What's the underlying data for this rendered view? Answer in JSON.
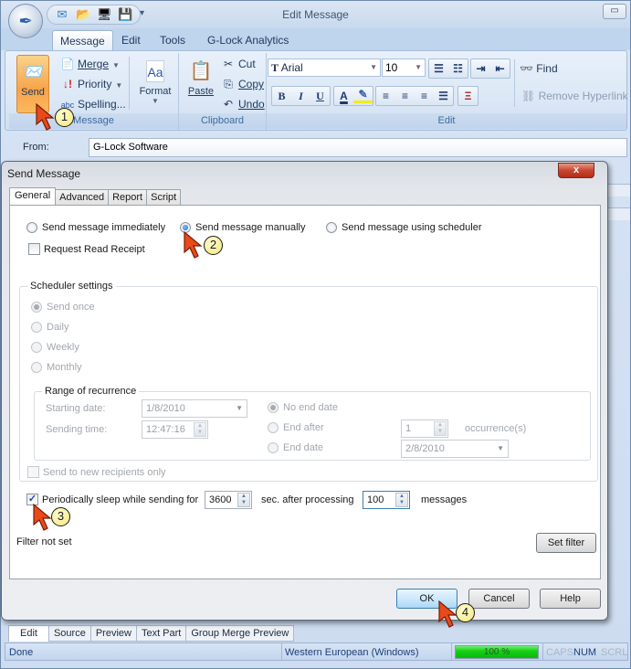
{
  "main_window": {
    "title": "Edit Message",
    "quick_access": [
      {
        "icon": "new-message-icon",
        "glyph": "✉"
      },
      {
        "icon": "open-folder-icon",
        "glyph": "📂"
      },
      {
        "icon": "connect-icon",
        "glyph": "🖥"
      },
      {
        "icon": "save-icon",
        "glyph": "💾"
      }
    ],
    "qat_more": "▾",
    "minimize": "▭",
    "ribbon_tabs": [
      "Message",
      "Edit",
      "Tools",
      "G-Lock Analytics"
    ],
    "active_ribbon_tab": "Message",
    "groups": {
      "message": {
        "label": "Message",
        "send": "Send",
        "merge": "Merge",
        "priority": "Priority",
        "spelling": "Spelling...",
        "format": "Format"
      },
      "clipboard": {
        "label": "Clipboard",
        "paste": "Paste",
        "cut": "Cut",
        "copy": "Copy",
        "undo": "Undo"
      },
      "edit": {
        "label": "Edit",
        "font": "Arial",
        "font_size": "10",
        "find": "Find",
        "remove_hyperlink": "Remove Hyperlink",
        "format_buttons": [
          "B",
          "I",
          "U"
        ]
      }
    },
    "from_label": "From:",
    "from_value": "G-Lock Software",
    "view_tabs": [
      "Edit",
      "Source",
      "Preview",
      "Text Part",
      "Group Merge Preview"
    ],
    "active_view_tab": "Edit",
    "status": {
      "text": "Done",
      "encoding": "Western European (Windows)",
      "progress_percent": 100,
      "progress_label": "100 %",
      "caps": "CAPS",
      "num": "NUM",
      "scrl": "SCRL"
    }
  },
  "dialog": {
    "title": "Send Message",
    "close": "x",
    "tabs": [
      "General",
      "Advanced",
      "Report",
      "Script"
    ],
    "active_tab": "General",
    "send_mode": {
      "options": [
        "Send message immediately",
        "Send message manually",
        "Send message using scheduler"
      ],
      "selected": "Send message manually"
    },
    "request_read_receipt": {
      "label": "Request Read Receipt",
      "checked": false
    },
    "scheduler": {
      "legend": "Scheduler settings",
      "frequency_options": [
        "Send once",
        "Daily",
        "Weekly",
        "Monthly"
      ],
      "frequency_selected": "Send once",
      "range": {
        "legend": "Range of recurrence",
        "starting_date_label": "Starting date:",
        "starting_date": "1/8/2010",
        "sending_time_label": "Sending time:",
        "sending_time": "12:47:16",
        "end_options": [
          "No end date",
          "End after",
          "End date"
        ],
        "end_selected": "No end date",
        "occurrences": "1",
        "occurrences_label": "occurrence(s)",
        "end_date": "2/8/2010"
      },
      "new_recipients_only": {
        "label": "Send to new recipients only",
        "checked": false
      }
    },
    "sleep": {
      "checked": true,
      "label": "Periodically sleep while sending for",
      "seconds": "3600",
      "after_label": "sec. after processing",
      "messages": "100",
      "messages_label": "messages"
    },
    "filter_status": "Filter not set",
    "set_filter": "Set filter",
    "ok": "OK",
    "cancel": "Cancel",
    "help": "Help"
  },
  "annotations": [
    "1",
    "2",
    "3",
    "4"
  ]
}
